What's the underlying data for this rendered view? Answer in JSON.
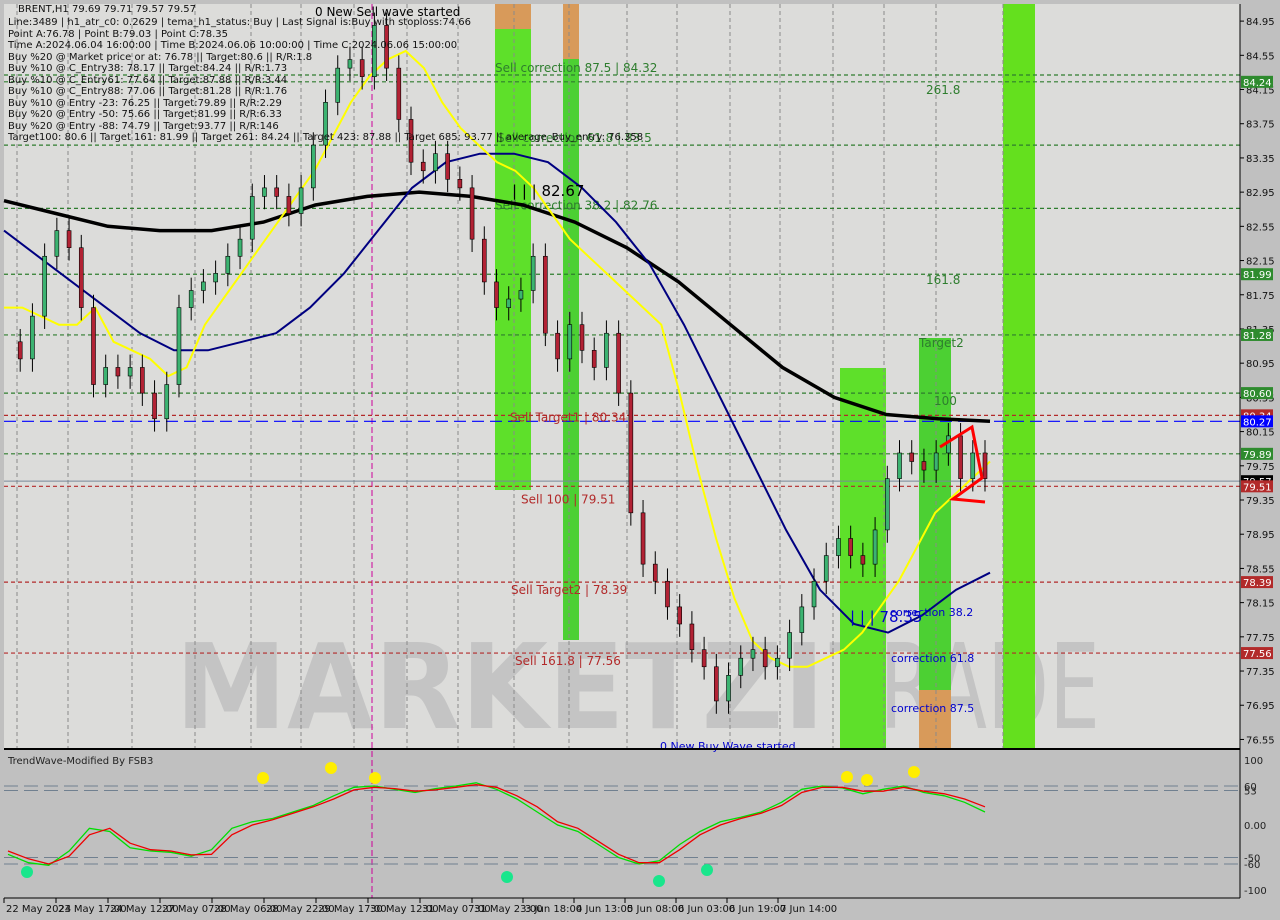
{
  "symbol_header": "BRENT,H1  79.69 79.71 79.57 79.57",
  "info_lines": [
    "Line:3489 | h1_atr_c0: 0.2629 | tema_h1_status: Buy | Last Signal is:Buy with stoploss:74.66",
    "Point A:76.78 | Point B:79.03 | Point C:78.35",
    "Time A:2024.06.04 16:00:00 | Time B:2024.06.06 10:00:00 | Time C:2024.06.06 15:00:00",
    "Buy %20 @ Market price or at: 76.78 || Target:80.6 || R/R:1.8",
    "Buy %10 @ C_Entry38: 78.17 || Target:84.24 || R/R:1.73",
    "Buy %10 @ C_Entry61: 77.64 || Target:87.88 || R/R:3.44",
    "Buy %10 @ C_Entry88: 77.06 || Target:81.28 || R/R:1.76",
    "Buy %10 @ Entry -23: 76.25 || Target:79.89 || R/R:2.29",
    "Buy %20 @ Entry -50: 75.66 || Target:81.99 || R/R:6.33",
    "Buy %20 @ Entry -88: 74.79 || Target:93.77 || R/R:146",
    "Target100: 80.6 || Target 161: 81.99 || Target 261: 84.24 || Target 423: 87.88 || Target 685: 93.77 || average_Buy_entry: 76.358"
  ],
  "chart_data": {
    "type": "candlestick",
    "title": "BRENT,H1",
    "ohlc_last": {
      "open": 79.69,
      "high": 79.71,
      "low": 79.57,
      "close": 79.57
    },
    "ylim": [
      76.45,
      85.15
    ],
    "y_ticks": [
      "84.95",
      "84.55",
      "84.15",
      "83.75",
      "83.35",
      "82.95",
      "82.55",
      "82.15",
      "81.75",
      "81.35",
      "80.95",
      "80.55",
      "80.15",
      "79.75",
      "79.35",
      "78.95",
      "78.55",
      "78.15",
      "77.75",
      "77.35",
      "76.95",
      "76.55"
    ],
    "x_ticks": [
      "22 May 2024",
      "23 May 17:00",
      "24 May 12:00",
      "27 May 07:00",
      "28 May 06:00",
      "28 May 22:00",
      "29 May 17:00",
      "30 May 12:00",
      "31 May 07:00",
      "31 May 23:00",
      "3 Jun 18:00",
      "4 Jun 13:00",
      "5 Jun 08:00",
      "6 Jun 03:00",
      "6 Jun 19:00",
      "7 Jun 14:00"
    ],
    "price_labels": [
      {
        "value": 84.24,
        "text": "84.24",
        "color": "#2e8b2e"
      },
      {
        "value": 81.99,
        "text": "81.99",
        "color": "#2e8b2e"
      },
      {
        "value": 81.28,
        "text": "81.28",
        "color": "#2e8b2e"
      },
      {
        "value": 80.6,
        "text": "80.60",
        "color": "#2e8b2e"
      },
      {
        "value": 80.34,
        "text": "80.34",
        "color": "#b22a2a"
      },
      {
        "value": 80.27,
        "text": "80.27",
        "color": "#0000ff"
      },
      {
        "value": 79.89,
        "text": "79.89",
        "color": "#2e8b2e"
      },
      {
        "value": 79.57,
        "text": "79.57",
        "color": "#000000"
      },
      {
        "value": 79.51,
        "text": "79.51",
        "color": "#b22a2a"
      },
      {
        "value": 78.39,
        "text": "78.39",
        "color": "#b22a2a"
      },
      {
        "value": 77.56,
        "text": "77.56",
        "color": "#b22a2a"
      }
    ],
    "horizontal_levels": [
      {
        "value": 84.32,
        "label": "Sell correction 87.5 | 84.32",
        "color": "#2e7d2e"
      },
      {
        "value": 84.24,
        "label": "261.8",
        "color": "#2e7d2e"
      },
      {
        "value": 83.5,
        "label": "Sell correction 61.8 | 83.5",
        "color": "#2e7d2e"
      },
      {
        "value": 82.76,
        "label": "Sell correction 38.2 | 82.76",
        "color": "#2e7d2e"
      },
      {
        "value": 81.99,
        "label": "161.8",
        "color": "#2e7d2e"
      },
      {
        "value": 81.28,
        "label": "Target2",
        "color": "#2e7d2e"
      },
      {
        "value": 80.6,
        "label": "100",
        "color": "#2e7d2e"
      },
      {
        "value": 80.34,
        "label": "Sell Target1 | 80.34",
        "color": "#b22a2a"
      },
      {
        "value": 80.27,
        "label": "",
        "color": "#0000ff"
      },
      {
        "value": 79.89,
        "label": "",
        "color": "#2e7d2e"
      },
      {
        "value": 79.51,
        "label": "Sell 100 | 79.51",
        "color": "#b22a2a"
      },
      {
        "value": 78.39,
        "label": "Sell Target2 | 78.39",
        "color": "#b22a2a"
      },
      {
        "value": 77.56,
        "label": "Sell 161.8 | 77.56",
        "color": "#b22a2a"
      }
    ],
    "annotations": [
      {
        "text": "0 New Sell wave started",
        "color": "#000000"
      },
      {
        "text": "0 New Buy Wave started",
        "color": "#0000cc"
      },
      {
        "text": "| | | 82.67",
        "color": "#000000"
      },
      {
        "text": "| | | 78.35",
        "color": "#0000cc"
      },
      {
        "text": "correction 38.2",
        "color": "#0000cc"
      },
      {
        "text": "correction 61.8",
        "color": "#0000cc"
      },
      {
        "text": "correction 87.5",
        "color": "#0000cc"
      }
    ],
    "watermark": "MARKETZITRADE",
    "series": [
      {
        "name": "close",
        "values": [
          81.2,
          81.0,
          81.5,
          82.2,
          82.5,
          82.3,
          81.6,
          80.7,
          80.9,
          80.8,
          80.9,
          80.6,
          80.3,
          80.7,
          81.6,
          81.8,
          81.9,
          82.0,
          82.2,
          82.4,
          82.9,
          83.0,
          82.9,
          82.7,
          83.0,
          83.5,
          84.0,
          84.4,
          84.5,
          84.3,
          84.9,
          84.4,
          83.8,
          83.3,
          83.2,
          83.4,
          83.1,
          83.0,
          82.4,
          81.9,
          81.6,
          81.7,
          81.8,
          82.2,
          81.3,
          81.0,
          81.4,
          81.1,
          80.9,
          81.3,
          80.6,
          79.2,
          78.6,
          78.4,
          78.1,
          77.9,
          77.6,
          77.4,
          77.0,
          77.3,
          77.5,
          77.6,
          77.4,
          77.5,
          77.8,
          78.1,
          78.4,
          78.7,
          78.9,
          78.7,
          78.6,
          79.0,
          79.6,
          79.9,
          79.8,
          79.7,
          79.9,
          80.1,
          79.6,
          79.9,
          79.6
        ]
      },
      {
        "name": "TEMA (yellow)",
        "values": [
          81.6,
          81.6,
          81.5,
          81.4,
          81.4,
          81.6,
          81.2,
          81.1,
          81.0,
          80.8,
          80.9,
          81.4,
          81.7,
          82.0,
          82.3,
          82.6,
          82.9,
          83.2,
          83.6,
          84.0,
          84.3,
          84.5,
          84.6,
          84.4,
          84.0,
          83.7,
          83.5,
          83.3,
          83.2,
          83.0,
          82.7,
          82.4,
          82.2,
          82.0,
          81.8,
          81.6,
          81.4,
          80.6,
          79.7,
          78.9,
          78.2,
          77.7,
          77.5,
          77.4,
          77.4,
          77.5,
          77.6,
          77.8,
          78.1,
          78.4,
          78.8,
          79.2,
          79.4,
          79.6,
          79.8
        ]
      },
      {
        "name": "MA blue",
        "values": [
          82.5,
          82.2,
          81.9,
          81.6,
          81.3,
          81.1,
          81.1,
          81.2,
          81.3,
          81.6,
          82.0,
          82.5,
          83.0,
          83.3,
          83.4,
          83.4,
          83.3,
          83.0,
          82.6,
          82.1,
          81.4,
          80.6,
          79.8,
          79.0,
          78.3,
          77.9,
          77.8,
          78.0,
          78.3,
          78.5
        ]
      },
      {
        "name": "MA black",
        "values": [
          82.85,
          82.7,
          82.55,
          82.5,
          82.5,
          82.6,
          82.8,
          82.9,
          82.95,
          82.9,
          82.8,
          82.6,
          82.3,
          81.9,
          81.4,
          80.9,
          80.55,
          80.35,
          80.3,
          80.27
        ]
      }
    ],
    "indicator": {
      "title": "TrendWave-Modified By FSB3",
      "ylim": [
        -100,
        100
      ],
      "y_ticks": [
        "100",
        "60",
        "53",
        "0.00",
        "-50",
        "-60",
        "-100"
      ],
      "levels": [
        60,
        53,
        -50,
        -60
      ],
      "series": [
        {
          "name": "green",
          "color": "#00dd00",
          "values": [
            -45,
            -58,
            -62,
            -40,
            -5,
            -10,
            -35,
            -40,
            -42,
            -48,
            -38,
            -5,
            5,
            10,
            20,
            30,
            45,
            58,
            60,
            55,
            50,
            56,
            60,
            65,
            55,
            40,
            20,
            0,
            -10,
            -30,
            -50,
            -60,
            -55,
            -30,
            -10,
            5,
            12,
            20,
            35,
            55,
            60,
            57,
            48,
            55,
            60,
            50,
            45,
            35,
            20
          ]
        },
        {
          "name": "red",
          "color": "#ee0000",
          "values": [
            -40,
            -52,
            -60,
            -48,
            -15,
            -5,
            -28,
            -38,
            -40,
            -46,
            -45,
            -15,
            0,
            8,
            18,
            28,
            40,
            54,
            58,
            56,
            52,
            54,
            58,
            62,
            58,
            45,
            28,
            5,
            -5,
            -25,
            -45,
            -58,
            -58,
            -38,
            -15,
            0,
            10,
            18,
            30,
            50,
            58,
            58,
            52,
            52,
            58,
            52,
            48,
            40,
            28
          ]
        }
      ],
      "signal_dots": [
        {
          "type": "buy",
          "color": "#19e68c"
        },
        {
          "type": "sell",
          "color": "#ffee00"
        }
      ]
    }
  }
}
